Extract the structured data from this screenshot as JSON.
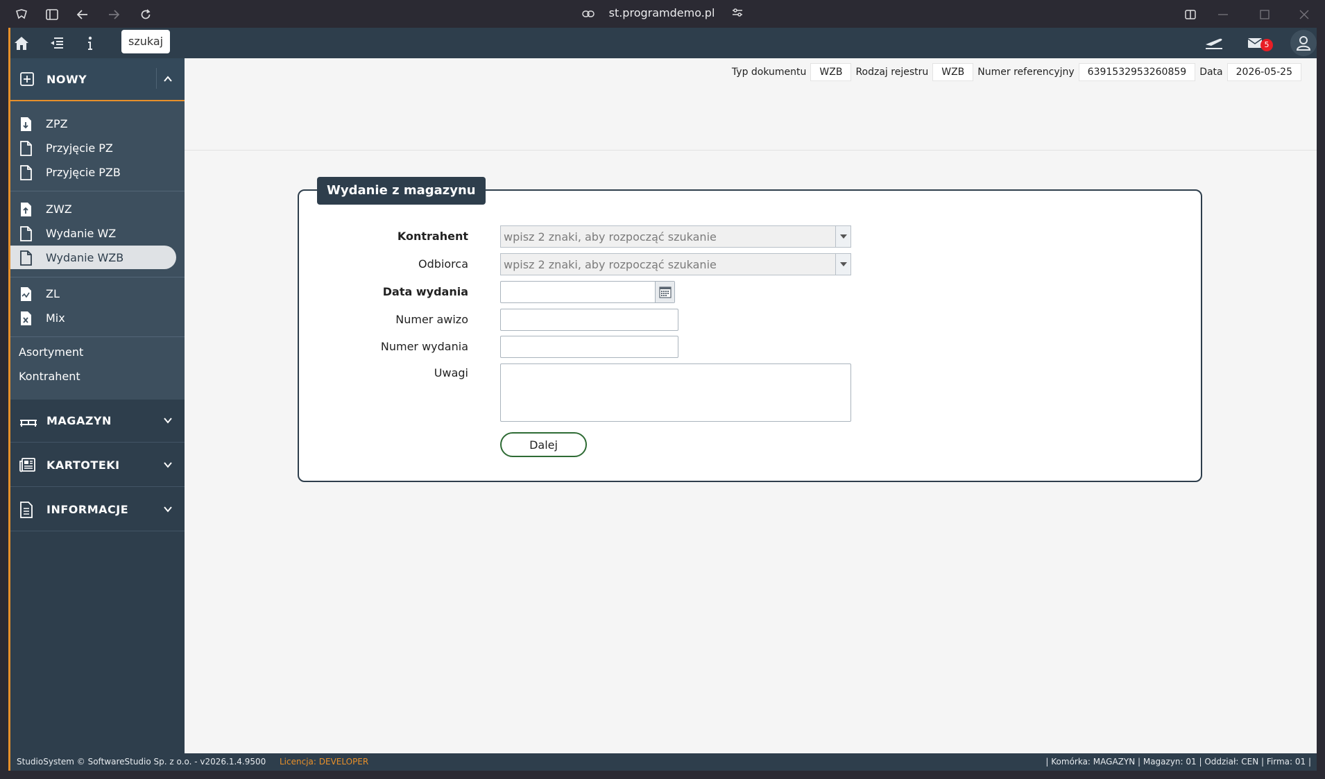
{
  "browser": {
    "url": "st.programdemo.pl"
  },
  "topbar": {
    "search_label": "szukaj",
    "mail_badge": "5"
  },
  "sidebar": {
    "nowy_label": "NOWY",
    "items": [
      {
        "label": "ZPZ",
        "icon": "document-download-icon"
      },
      {
        "label": "Przyjęcie PZ",
        "icon": "document-icon"
      },
      {
        "label": "Przyjęcie PZB",
        "icon": "document-icon"
      },
      {
        "label": "ZWZ",
        "icon": "document-upload-icon"
      },
      {
        "label": "Wydanie WZ",
        "icon": "document-icon"
      },
      {
        "label": "Wydanie WZB",
        "icon": "document-icon",
        "active": true
      },
      {
        "label": "ZL",
        "icon": "document-chart-icon"
      },
      {
        "label": "Mix",
        "icon": "document-x-icon"
      }
    ],
    "links": [
      "Asortyment",
      "Kontrahent"
    ],
    "sections": [
      {
        "label": "MAGAZYN",
        "icon": "shelf-icon"
      },
      {
        "label": "KARTOTEKI",
        "icon": "newspaper-icon"
      },
      {
        "label": "INFORMACJE",
        "icon": "document-text-icon"
      }
    ]
  },
  "header": {
    "typ_label": "Typ dokumentu",
    "typ_value": "WZB",
    "rodzaj_label": "Rodzaj rejestru",
    "rodzaj_value": "WZB",
    "numer_label": "Numer referencyjny",
    "numer_value": "6391532953260859",
    "data_label": "Data",
    "data_value": "2026-05-25"
  },
  "form": {
    "title": "Wydanie z magazynu",
    "kontrahent_label": "Kontrahent",
    "kontrahent_placeholder": "wpisz 2 znaki, aby rozpocząć szukanie",
    "odbiorca_label": "Odbiorca",
    "odbiorca_placeholder": "wpisz 2 znaki, aby rozpocząć szukanie",
    "data_label": "Data wydania",
    "data_value": "",
    "awizo_label": "Numer awizo",
    "awizo_value": "",
    "numer_label": "Numer wydania",
    "numer_value": "",
    "uwagi_label": "Uwagi",
    "uwagi_value": "",
    "submit_label": "Dalej"
  },
  "footer": {
    "copyright": "StudioSystem © SoftwareStudio Sp. z o.o. - v2026.1.4.9500",
    "license": "Licencja: DEVELOPER",
    "context": "| Komórka: MAGAZYN | Magazyn: 01 | Oddział: CEN | Firma: 01 |"
  },
  "colors": {
    "sidebar": "#2e3e4c",
    "accent": "#e8902a",
    "button_border": "#2e6b34",
    "badge": "#e81e25"
  }
}
